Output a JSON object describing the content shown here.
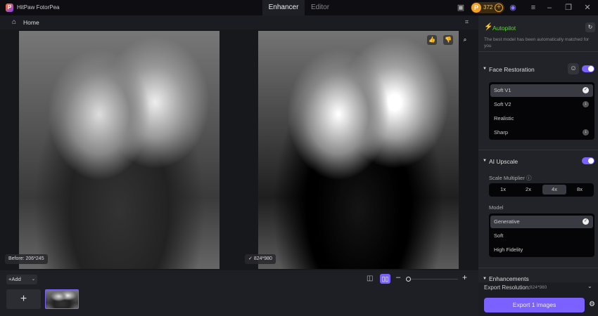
{
  "app": {
    "title": "HitPaw FotorPea",
    "logo": "P"
  },
  "tabs": [
    {
      "label": "Enhancer",
      "active": true
    },
    {
      "label": "Editor",
      "active": false
    }
  ],
  "titlebar": {
    "coins": "372"
  },
  "home": {
    "label": "Home"
  },
  "canvas": {
    "before_label": "Before: 206*245",
    "after_label": "824*980"
  },
  "bottom": {
    "add_label": "Add"
  },
  "panel": {
    "autopilot": {
      "title": "Autopilot",
      "desc": "The best model has been automatically matched for you"
    },
    "face_restoration": {
      "title": "Face Restoration",
      "enabled": true,
      "options": [
        {
          "label": "Soft V1",
          "state": "selected"
        },
        {
          "label": "Soft V2",
          "state": "download"
        },
        {
          "label": "Realistic",
          "state": ""
        },
        {
          "label": "Sharp",
          "state": "download"
        }
      ]
    },
    "ai_upscale": {
      "title": "AI Upscale",
      "enabled": true,
      "scale_label": "Scale Multiplier",
      "scales": [
        "1x",
        "2x",
        "4x",
        "8x"
      ],
      "selected_scale": "4x",
      "model_label": "Model",
      "models": [
        {
          "label": "Generative",
          "state": "selected"
        },
        {
          "label": "Soft",
          "state": ""
        },
        {
          "label": "High Fidelity",
          "state": ""
        }
      ]
    },
    "enhancements": {
      "title": "Enhancements"
    },
    "export": {
      "resolution_label": "Export Resolution:",
      "resolution_value": "824*980",
      "button": "Export 1 images"
    }
  },
  "colors": {
    "accent": "#7b61ff",
    "autopilot": "#5bd62b"
  }
}
